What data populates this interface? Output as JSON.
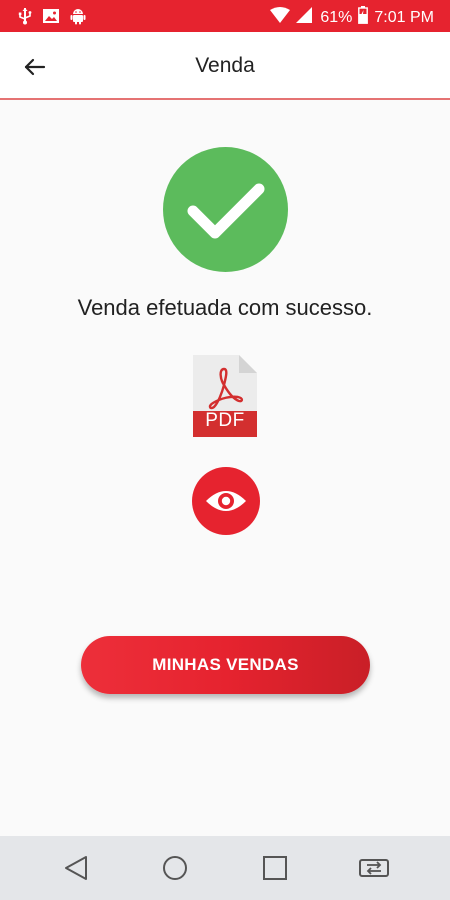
{
  "status_bar": {
    "battery_percent": "61%",
    "time": "7:01 PM",
    "color": "#e6232f"
  },
  "app_bar": {
    "title": "Venda",
    "back_icon": "arrow-left-icon"
  },
  "content": {
    "success_icon": "check-circle-icon",
    "success_color": "#5cbb5c",
    "message": "Venda efetuada com sucesso.",
    "pdf_label": "PDF",
    "view_icon": "eye-icon"
  },
  "actions": {
    "primary_label": "MINHAS VENDAS",
    "primary_color": "#e6232f"
  },
  "navigation": {
    "items": [
      "back-triangle-icon",
      "home-circle-icon",
      "recents-square-icon",
      "switch-app-icon"
    ]
  }
}
